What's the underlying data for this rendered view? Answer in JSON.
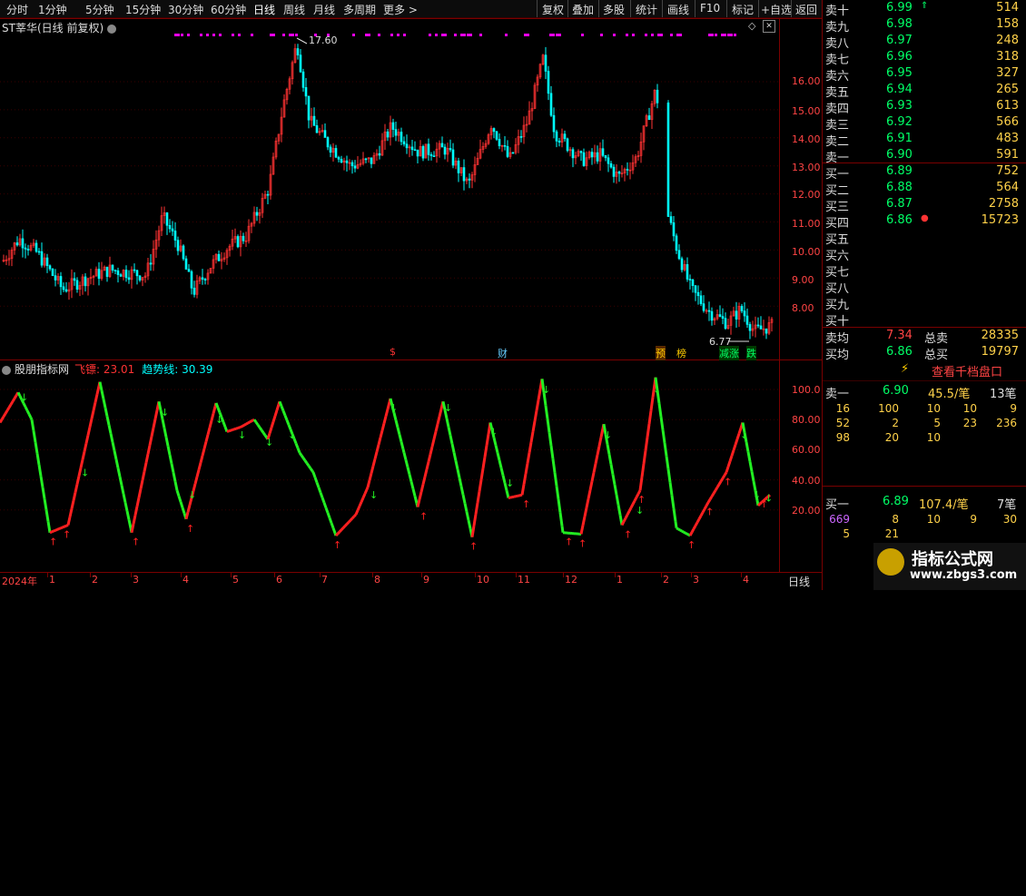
{
  "toolbar": {
    "left": [
      "分时",
      "1分钟",
      "5分钟",
      "15分钟",
      "30分钟",
      "60分钟",
      "日线",
      "周线",
      "月线",
      "多周期",
      "更多 >"
    ],
    "right": [
      "复权",
      "叠加",
      "多股",
      "统计",
      "画线",
      "F10",
      "标记",
      "+自选",
      "返回"
    ]
  },
  "chart": {
    "title": "ST莘华(日线 前复权)",
    "high_label": "17.60",
    "low_label": "6.77",
    "yaxis": [
      "16.00",
      "15.00",
      "14.00",
      "13.00",
      "12.00",
      "11.00",
      "10.00",
      "9.00",
      "8.00"
    ],
    "event_markers": [
      {
        "text": "$",
        "color": "#ff3333"
      },
      {
        "text": "财",
        "color": "#66ccff"
      },
      {
        "text": "预",
        "color": "#ffcc00"
      },
      {
        "text": "榜",
        "color": "#ffcc00"
      },
      {
        "text": "减涨",
        "color": "#00ff66"
      },
      {
        "text": "跌",
        "color": "#00ff66"
      }
    ]
  },
  "indicator": {
    "title": "股朋指标网",
    "line1_label": "飞镖: 23.01",
    "line2_label": "趋势线: 30.39",
    "yaxis": [
      "100.0",
      "80.00",
      "60.00",
      "40.00",
      "20.00"
    ]
  },
  "xaxis": {
    "year_label": "2024年",
    "months": [
      "1",
      "2",
      "3",
      "4",
      "5",
      "6",
      "7",
      "8",
      "9",
      "10",
      "11",
      "12",
      "1",
      "2",
      "3",
      "4"
    ],
    "period": "日线"
  },
  "quote": {
    "sell": [
      {
        "name": "卖十",
        "price": "6.99",
        "vol": "514"
      },
      {
        "name": "卖九",
        "price": "6.98",
        "vol": "158"
      },
      {
        "name": "卖八",
        "price": "6.97",
        "vol": "248"
      },
      {
        "name": "卖七",
        "price": "6.96",
        "vol": "318"
      },
      {
        "name": "卖六",
        "price": "6.95",
        "vol": "327"
      },
      {
        "name": "卖五",
        "price": "6.94",
        "vol": "265"
      },
      {
        "name": "卖四",
        "price": "6.93",
        "vol": "613"
      },
      {
        "name": "卖三",
        "price": "6.92",
        "vol": "566"
      },
      {
        "name": "卖二",
        "price": "6.91",
        "vol": "483"
      },
      {
        "name": "卖一",
        "price": "6.90",
        "vol": "591"
      }
    ],
    "buy": [
      {
        "name": "买一",
        "price": "6.89",
        "vol": "752"
      },
      {
        "name": "买二",
        "price": "6.88",
        "vol": "564"
      },
      {
        "name": "买三",
        "price": "6.87",
        "vol": "2758"
      },
      {
        "name": "买四",
        "price": "6.86",
        "vol": "15723"
      },
      {
        "name": "买五",
        "price": "",
        "vol": ""
      },
      {
        "name": "买六",
        "price": "",
        "vol": ""
      },
      {
        "name": "买七",
        "price": "",
        "vol": ""
      },
      {
        "name": "买八",
        "price": "",
        "vol": ""
      },
      {
        "name": "买九",
        "price": "",
        "vol": ""
      },
      {
        "name": "买十",
        "price": "",
        "vol": ""
      }
    ],
    "sell_avg": {
      "name": "卖均",
      "price": "7.34",
      "label": "总卖",
      "vol": "28335"
    },
    "buy_avg": {
      "name": "买均",
      "price": "6.86",
      "label": "总买",
      "vol": "19797"
    }
  },
  "depth": {
    "button": "查看千档盘口",
    "sell1": {
      "name": "卖一",
      "price": "6.90",
      "per": "45.5/笔",
      "count": "13笔"
    },
    "sell_rows": [
      [
        "16",
        "100",
        "10",
        "10",
        "9"
      ],
      [
        "52",
        "2",
        "5",
        "23",
        "236"
      ],
      [
        "98",
        "20",
        "10",
        "",
        ""
      ]
    ],
    "buy1": {
      "name": "买一",
      "price": "6.89",
      "per": "107.4/笔",
      "count": "7笔"
    },
    "buy_rows": [
      [
        "669",
        "8",
        "10",
        "9",
        "30"
      ],
      [
        "5",
        "21",
        "",
        "",
        ""
      ]
    ]
  },
  "watermark": {
    "line1": "指标公式网",
    "line2": "www.zbgs3.com"
  },
  "colors": {
    "up": "#ff3333",
    "down": "#00ffff",
    "buy_line": "#ff2020",
    "sell_line": "#22ee22"
  }
}
